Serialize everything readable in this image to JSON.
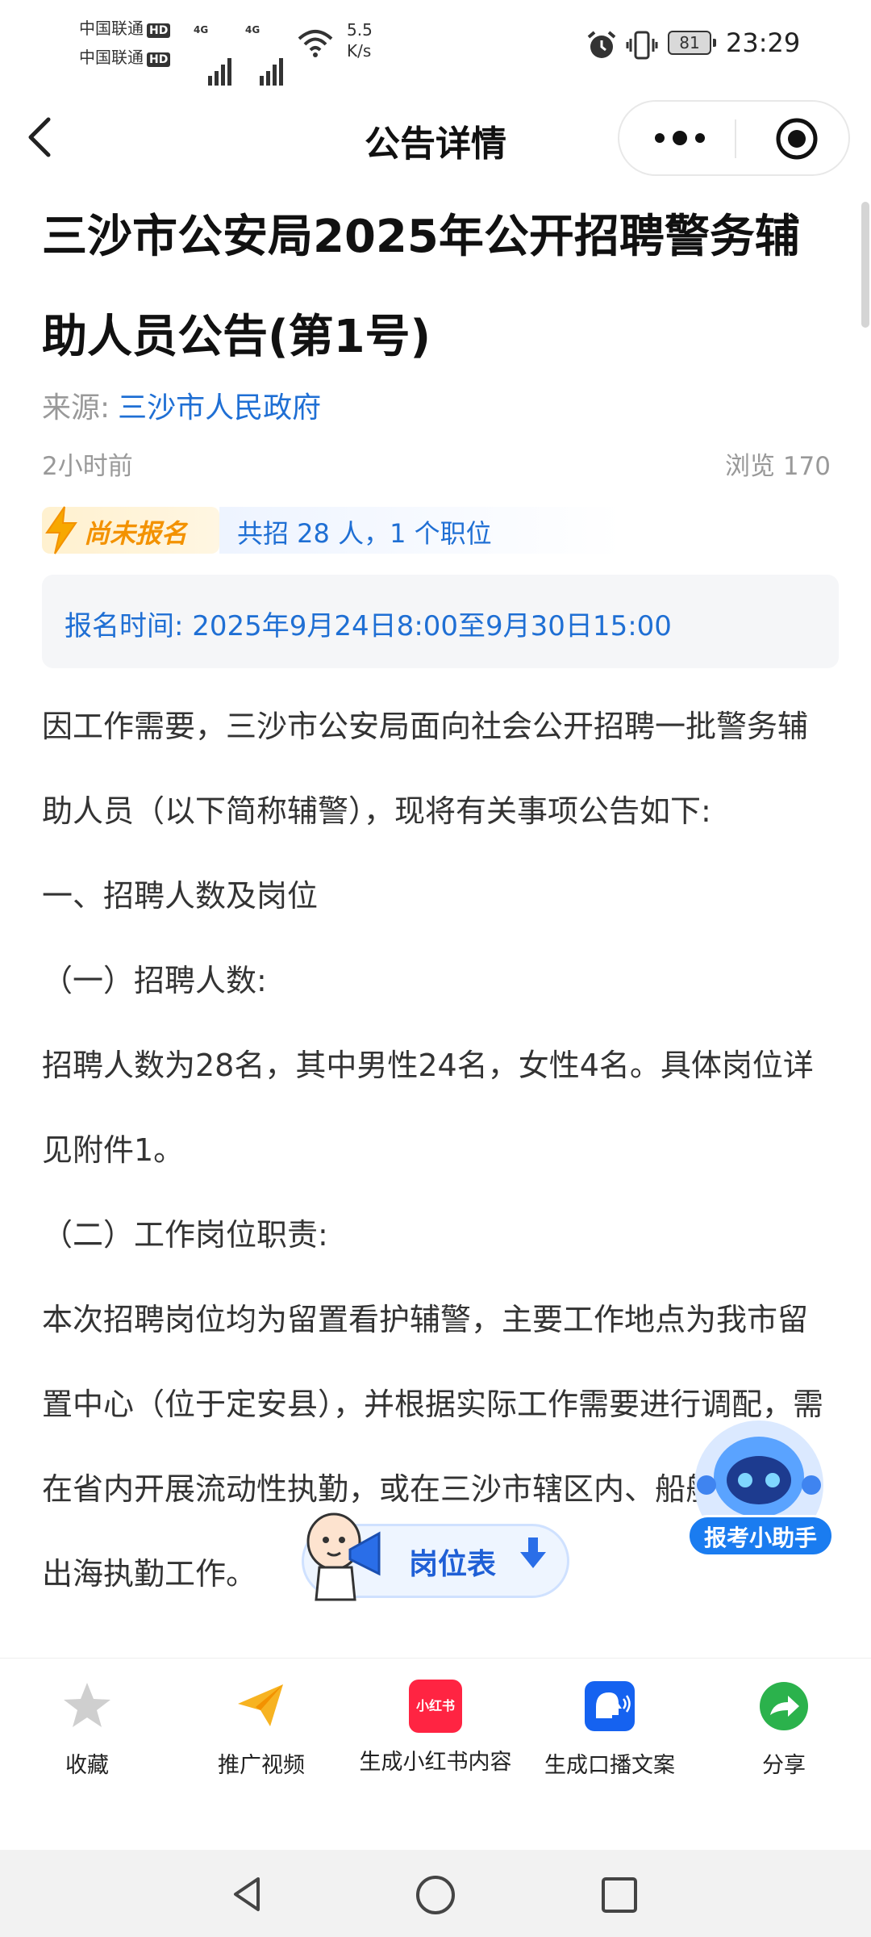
{
  "status_bar": {
    "carrier1": "中国联通",
    "carrier2": "中国联通",
    "hd": "HD",
    "network": "4G",
    "speed_value": "5.5",
    "speed_unit": "K/s",
    "battery": "81",
    "time": "23:29"
  },
  "header": {
    "title": "公告详情",
    "back_icon": "chevron-left-icon",
    "more_icon": "more-dots-icon",
    "target_icon": "target-icon"
  },
  "article": {
    "title": "三沙市公安局2025年公开招聘警务辅助人员公告(第1号)",
    "source_label": "来源:",
    "source_name": "三沙市人民政府",
    "time_ago": "2小时前",
    "views": "浏览 170",
    "status": "尚未报名",
    "quota": "共招 28 人，1 个职位",
    "registration_time": "报名时间: 2025年9月24日8:00至9月30日15:00",
    "paragraphs": [
      "因工作需要，三沙市公安局面向社会公开招聘一批警务辅助人员（以下简称辅警），现将有关事项公告如下:",
      "一、招聘人数及岗位",
      "（一）招聘人数:",
      "招聘人数为28名，其中男性24名，女性4名。具体岗位详见附件1。",
      "（二）工作岗位职责:",
      "本次招聘岗位均为留置看护辅警，主要工作地点为我市留置中心（位于定安县），并根据实际工作需要进行调配，需在省内开展流动性执勤，或在三沙市辖区内、船舶上开展出海执勤工作。"
    ]
  },
  "floating": {
    "job_table": "岗位表",
    "assistant": "报考小助手"
  },
  "actions": [
    {
      "label": "收藏",
      "icon": "star-icon"
    },
    {
      "label": "推广视频",
      "icon": "paper-plane-icon"
    },
    {
      "label": "生成小红书内容",
      "icon": "xiaohongshu-icon",
      "badge": "小红书"
    },
    {
      "label": "生成口播文案",
      "icon": "speaking-head-icon"
    },
    {
      "label": "分享",
      "icon": "share-arrow-icon"
    }
  ],
  "colors": {
    "accent": "#1f6fd4",
    "status_orange": "#f39200",
    "xhs_red": "#ff2442",
    "share_green": "#2bb24c"
  }
}
